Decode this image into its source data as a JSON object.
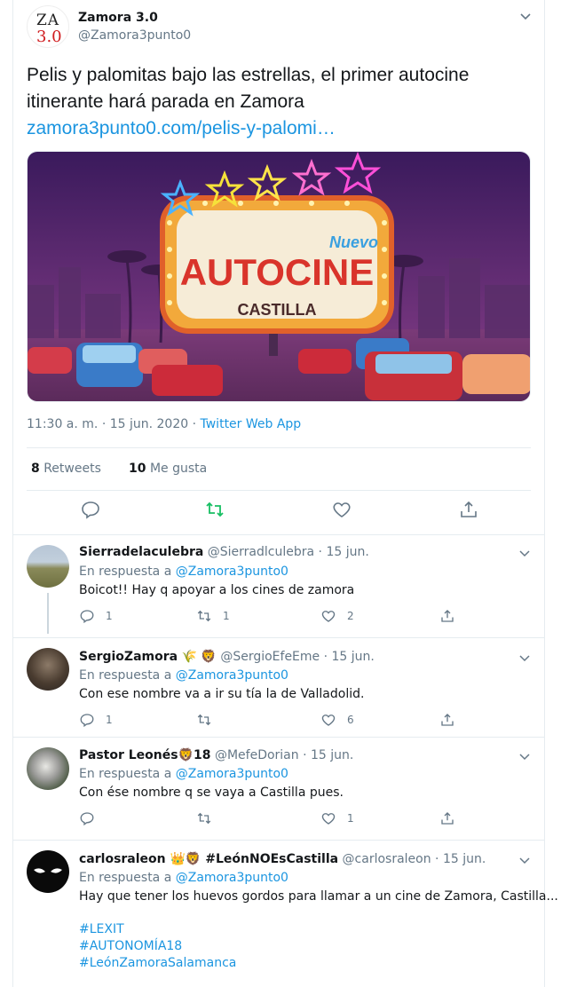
{
  "tweet": {
    "display_name": "Zamora 3.0",
    "handle": "@Zamora3punto0",
    "logo_line1": "ZA",
    "logo_line2": "3.0",
    "text": "Pelis y palomitas bajo las estrellas, el primer autocine itinerante hará parada en Zamora",
    "link": "zamora3punto0.com/pelis-y-palomi…",
    "image_sign": {
      "small_word": "Nuevo",
      "big_word": "AUTOCINE",
      "sub_word": "CASTILLA"
    },
    "time": "11:30 a. m. · 15 jun. 2020 · ",
    "app": "Twitter Web App",
    "retweets_count": "8",
    "retweets_label": "Retweets",
    "likes_count": "10",
    "likes_label": "Me gusta"
  },
  "icons": {
    "reply": "reply-icon",
    "retweet": "retweet-icon",
    "like": "heart-icon",
    "share": "share-icon",
    "caret": "chevron-down-icon"
  },
  "colors": {
    "link": "#1b95e0",
    "retweet_active": "#17bf63",
    "secondary": "#657786"
  },
  "replies": [
    {
      "name": "Sierradelaculebra",
      "handle": "@Sierradlculebra · 15 jun.",
      "in_reply_prefix": "En respuesta a ",
      "mention": "@Zamora3punto0",
      "text": "Boicot!! Hay q apoyar a los cines de zamora",
      "replies": "1",
      "retweets": "1",
      "likes": "2"
    },
    {
      "name": "SergioZamora",
      "name_emoji": "🌾 🦁",
      "handle": "@SergioEfeEme · 15 jun.",
      "in_reply_prefix": "En respuesta a ",
      "mention": "@Zamora3punto0",
      "text": "Con ese nombre va a ir su tía la de Valladolid.",
      "replies": "1",
      "retweets": "",
      "likes": "6"
    },
    {
      "name": "Pastor Leonés🦁18",
      "handle": "@MefeDorian · 15 jun.",
      "in_reply_prefix": "En respuesta a ",
      "mention": "@Zamora3punto0",
      "text": "Con ése nombre q se vaya a Castilla pues.",
      "replies": "",
      "retweets": "",
      "likes": "1"
    },
    {
      "name": "carlosraleon 👑🦁 #LeónNOEsCastilla",
      "handle": "@carlosraleon · 15 jun.",
      "in_reply_prefix": "En respuesta a ",
      "mention": "@Zamora3punto0",
      "text": "Hay que tener los huevos gordos para llamar a un cine de Zamora, Castilla...",
      "tags": [
        "#LEXIT",
        "#AUTONOMÍA18",
        "#LeónZamoraSalamanca"
      ]
    }
  ]
}
